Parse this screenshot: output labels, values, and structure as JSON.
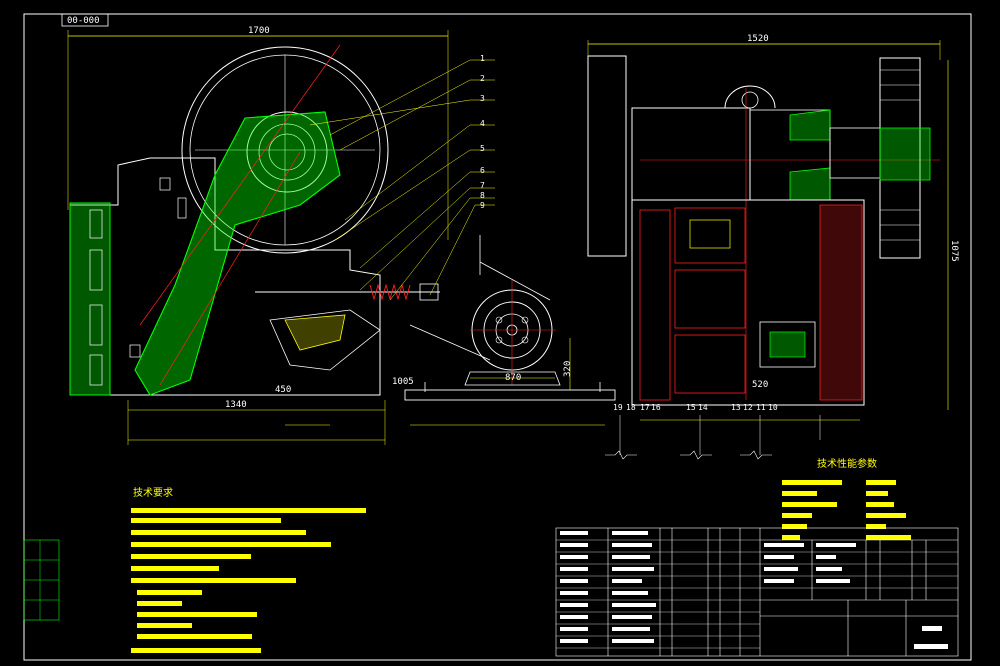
{
  "drawing": {
    "title_tag": "00-000",
    "colors": {
      "background": "#000000",
      "frame": "#ffffff",
      "outline": "#ffffff",
      "hatch": "#00ff00",
      "center_line": "#ff2020",
      "dimension": "#ffff00",
      "leader": "#ffff00",
      "text_yellow": "#ffff00"
    }
  },
  "dimensions": {
    "front_width": "1700",
    "side_width": "1520",
    "side_height": "1075",
    "base_height": "1005",
    "span_1340": "1340",
    "span_450": "450",
    "motor_870": "870",
    "motor_320": "320",
    "side_520": "520"
  },
  "callouts": {
    "front": [
      "1",
      "2",
      "3",
      "4",
      "5",
      "6",
      "7",
      "8",
      "9"
    ],
    "side": [
      "19",
      "18",
      "17",
      "16",
      "15",
      "14",
      "13",
      "12",
      "11",
      "10"
    ]
  },
  "tech_requirements": {
    "heading": "技术要求"
  },
  "tech_params": {
    "heading": "技术性能参数"
  }
}
